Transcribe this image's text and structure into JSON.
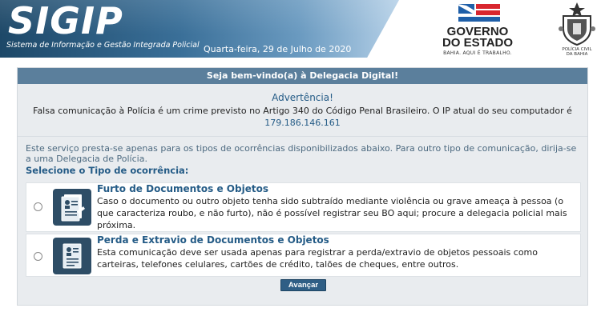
{
  "header": {
    "logo": "SIGIP",
    "logo_subtitle": "Sistema de Informação e Gestão Integrada Policial",
    "date": "Quarta-feira, 29 de Julho de 2020",
    "gov_name_line1": "GOVERNO",
    "gov_name_line2": "DO ESTADO",
    "gov_tagline": "BAHIA. AQUI É TRABALHO.",
    "police_label_line1": "POLÍCIA CIVIL",
    "police_label_line2": "DA BAHIA"
  },
  "panel": {
    "title": "Seja bem-vindo(a) à Delegacia Digital!",
    "warning_title": "Advertência!",
    "warning_text": "Falsa comunicação à Polícia é um crime previsto no Artigo 340 do Código Penal Brasileiro. O IP atual do seu computador é ",
    "ip": "179.186.146.161",
    "info_text": "Este serviço presta-se apenas para os tipos de ocorrências disponibilizados abaixo. Para outro tipo de comunicação, dirija-se a uma Delegacia de Polícia.",
    "select_label": "Selecione o Tipo de ocorrência:",
    "options": [
      {
        "title": "Furto de Documentos e Objetos",
        "description": "Caso o documento ou outro objeto tenha sido subtraído mediante violência ou grave ameaça à pessoa (o que caracteriza roubo, e não furto), não é possível registrar seu BO aqui; procure a delegacia policial mais próxima.",
        "icon": "document-theft-icon"
      },
      {
        "title": "Perda e Extravio de Documentos e Objetos",
        "description": "Esta comunicação deve ser usada apenas para registrar a perda/extravio de objetos pessoais como carteiras, telefones celulares, cartões de crédito, talões de cheques, entre outros.",
        "icon": "document-loss-icon"
      }
    ],
    "submit_label": "Avançar"
  }
}
